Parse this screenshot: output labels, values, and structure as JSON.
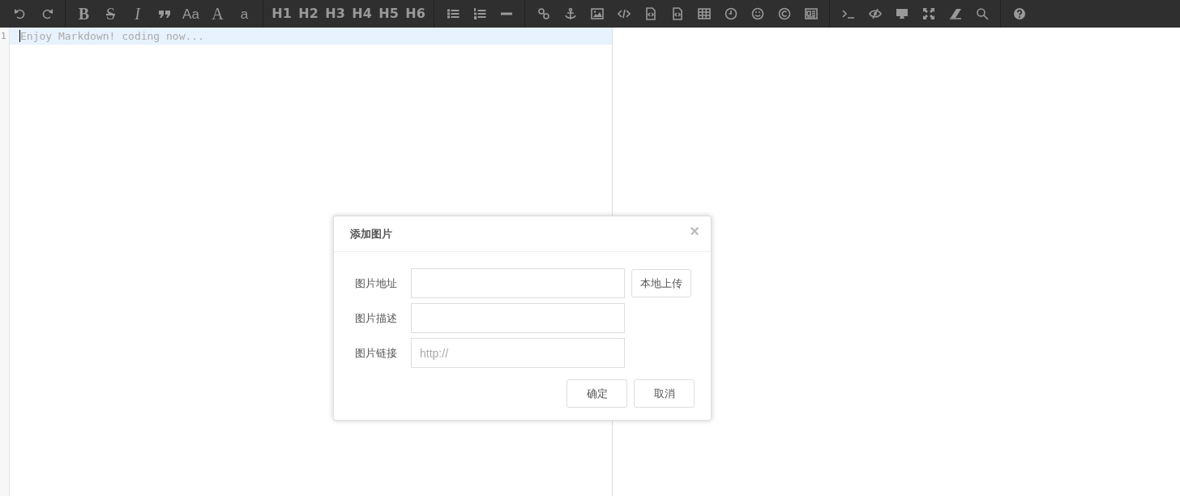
{
  "toolbar": {
    "groups": [
      [
        {
          "kind": "undo"
        },
        {
          "kind": "redo"
        }
      ],
      [
        {
          "kind": "bold-text",
          "label": "B"
        },
        {
          "kind": "strike-text",
          "label": "S"
        },
        {
          "kind": "italic-text",
          "label": "I"
        },
        {
          "kind": "quote"
        },
        {
          "kind": "plain-text",
          "label": "Aa"
        },
        {
          "kind": "serif-text",
          "label": "A"
        },
        {
          "kind": "plain-text",
          "label": "a"
        }
      ],
      [
        {
          "kind": "heading-text",
          "label": "H1"
        },
        {
          "kind": "heading-text",
          "label": "H2"
        },
        {
          "kind": "heading-text",
          "label": "H3"
        },
        {
          "kind": "heading-text",
          "label": "H4"
        },
        {
          "kind": "heading-text",
          "label": "H5"
        },
        {
          "kind": "heading-text",
          "label": "H6"
        }
      ],
      [
        {
          "kind": "list"
        },
        {
          "kind": "numbered-list"
        },
        {
          "kind": "rule"
        }
      ],
      [
        {
          "kind": "link"
        },
        {
          "kind": "anchor"
        },
        {
          "kind": "image"
        },
        {
          "kind": "code"
        },
        {
          "kind": "code-file"
        },
        {
          "kind": "code-file"
        },
        {
          "kind": "table"
        },
        {
          "kind": "clock"
        },
        {
          "kind": "smiley"
        },
        {
          "kind": "copyright"
        },
        {
          "kind": "newspaper"
        }
      ],
      [
        {
          "kind": "terminal"
        },
        {
          "kind": "eye-slash"
        },
        {
          "kind": "monitor"
        },
        {
          "kind": "expand"
        },
        {
          "kind": "eraser"
        },
        {
          "kind": "search"
        }
      ],
      [
        {
          "kind": "help"
        }
      ]
    ]
  },
  "editor": {
    "lines": [
      {
        "number": "1",
        "placeholder": "Enjoy Markdown! coding now...",
        "active": true
      }
    ]
  },
  "dialog": {
    "title": "添加图片",
    "close": "×",
    "fields": [
      {
        "label": "图片地址",
        "side_button": "本地上传"
      },
      {
        "label": "图片描述"
      },
      {
        "label": "图片链接",
        "placeholder": "http://"
      }
    ],
    "buttons": [
      "确定",
      "取消"
    ]
  }
}
